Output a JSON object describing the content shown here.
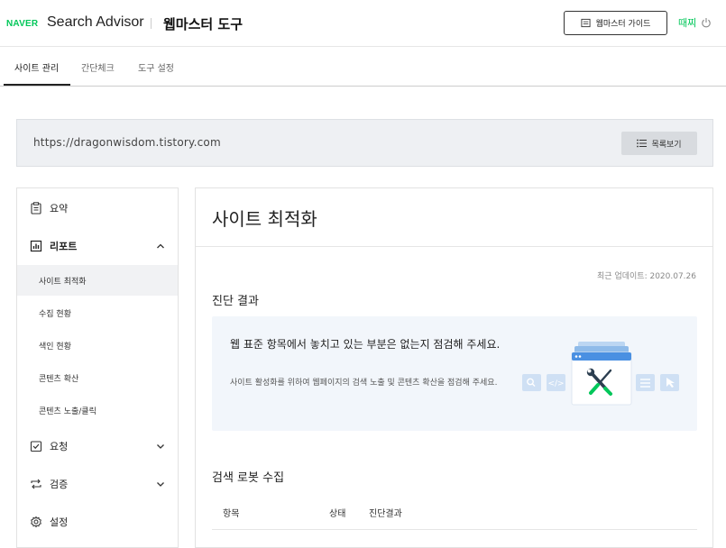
{
  "header": {
    "brand": "NAVER",
    "product": "Search Advisor",
    "tool_title": "웹마스터 도구",
    "guide_button": "웹마스터 가이드",
    "user_name": "때찌"
  },
  "tabs": [
    {
      "label": "사이트 관리",
      "active": true
    },
    {
      "label": "간단체크",
      "active": false
    },
    {
      "label": "도구 설정",
      "active": false
    }
  ],
  "site": {
    "url": "https://dragonwisdom.tistory.com",
    "list_button": "목록보기"
  },
  "sidebar": {
    "summary": "요약",
    "report": "리포트",
    "report_items": [
      "사이트 최적화",
      "수집 현황",
      "색인 현황",
      "콘텐츠 확산",
      "콘텐츠 노출/클릭"
    ],
    "request": "요청",
    "verify": "검증",
    "settings": "설정"
  },
  "main": {
    "title": "사이트 최적화",
    "updated": "최근 업데이트: 2020.07.26",
    "diagnosis_title": "진단 결과",
    "diagnosis_main": "웹 표준 항목에서 놓치고 있는 부분은 없는지 점검해 주세요.",
    "diagnosis_sub": "사이트 활성화를 위하여 웹페이지의 검색 노출 및 콘텐츠 확산을 점검해 주세요.",
    "robot_title": "검색 로봇 수집",
    "table_headers": [
      "항목",
      "상태",
      "진단결과"
    ]
  },
  "colors": {
    "brand_green": "#03c75a",
    "illustration_blue": "#4a90e2"
  }
}
